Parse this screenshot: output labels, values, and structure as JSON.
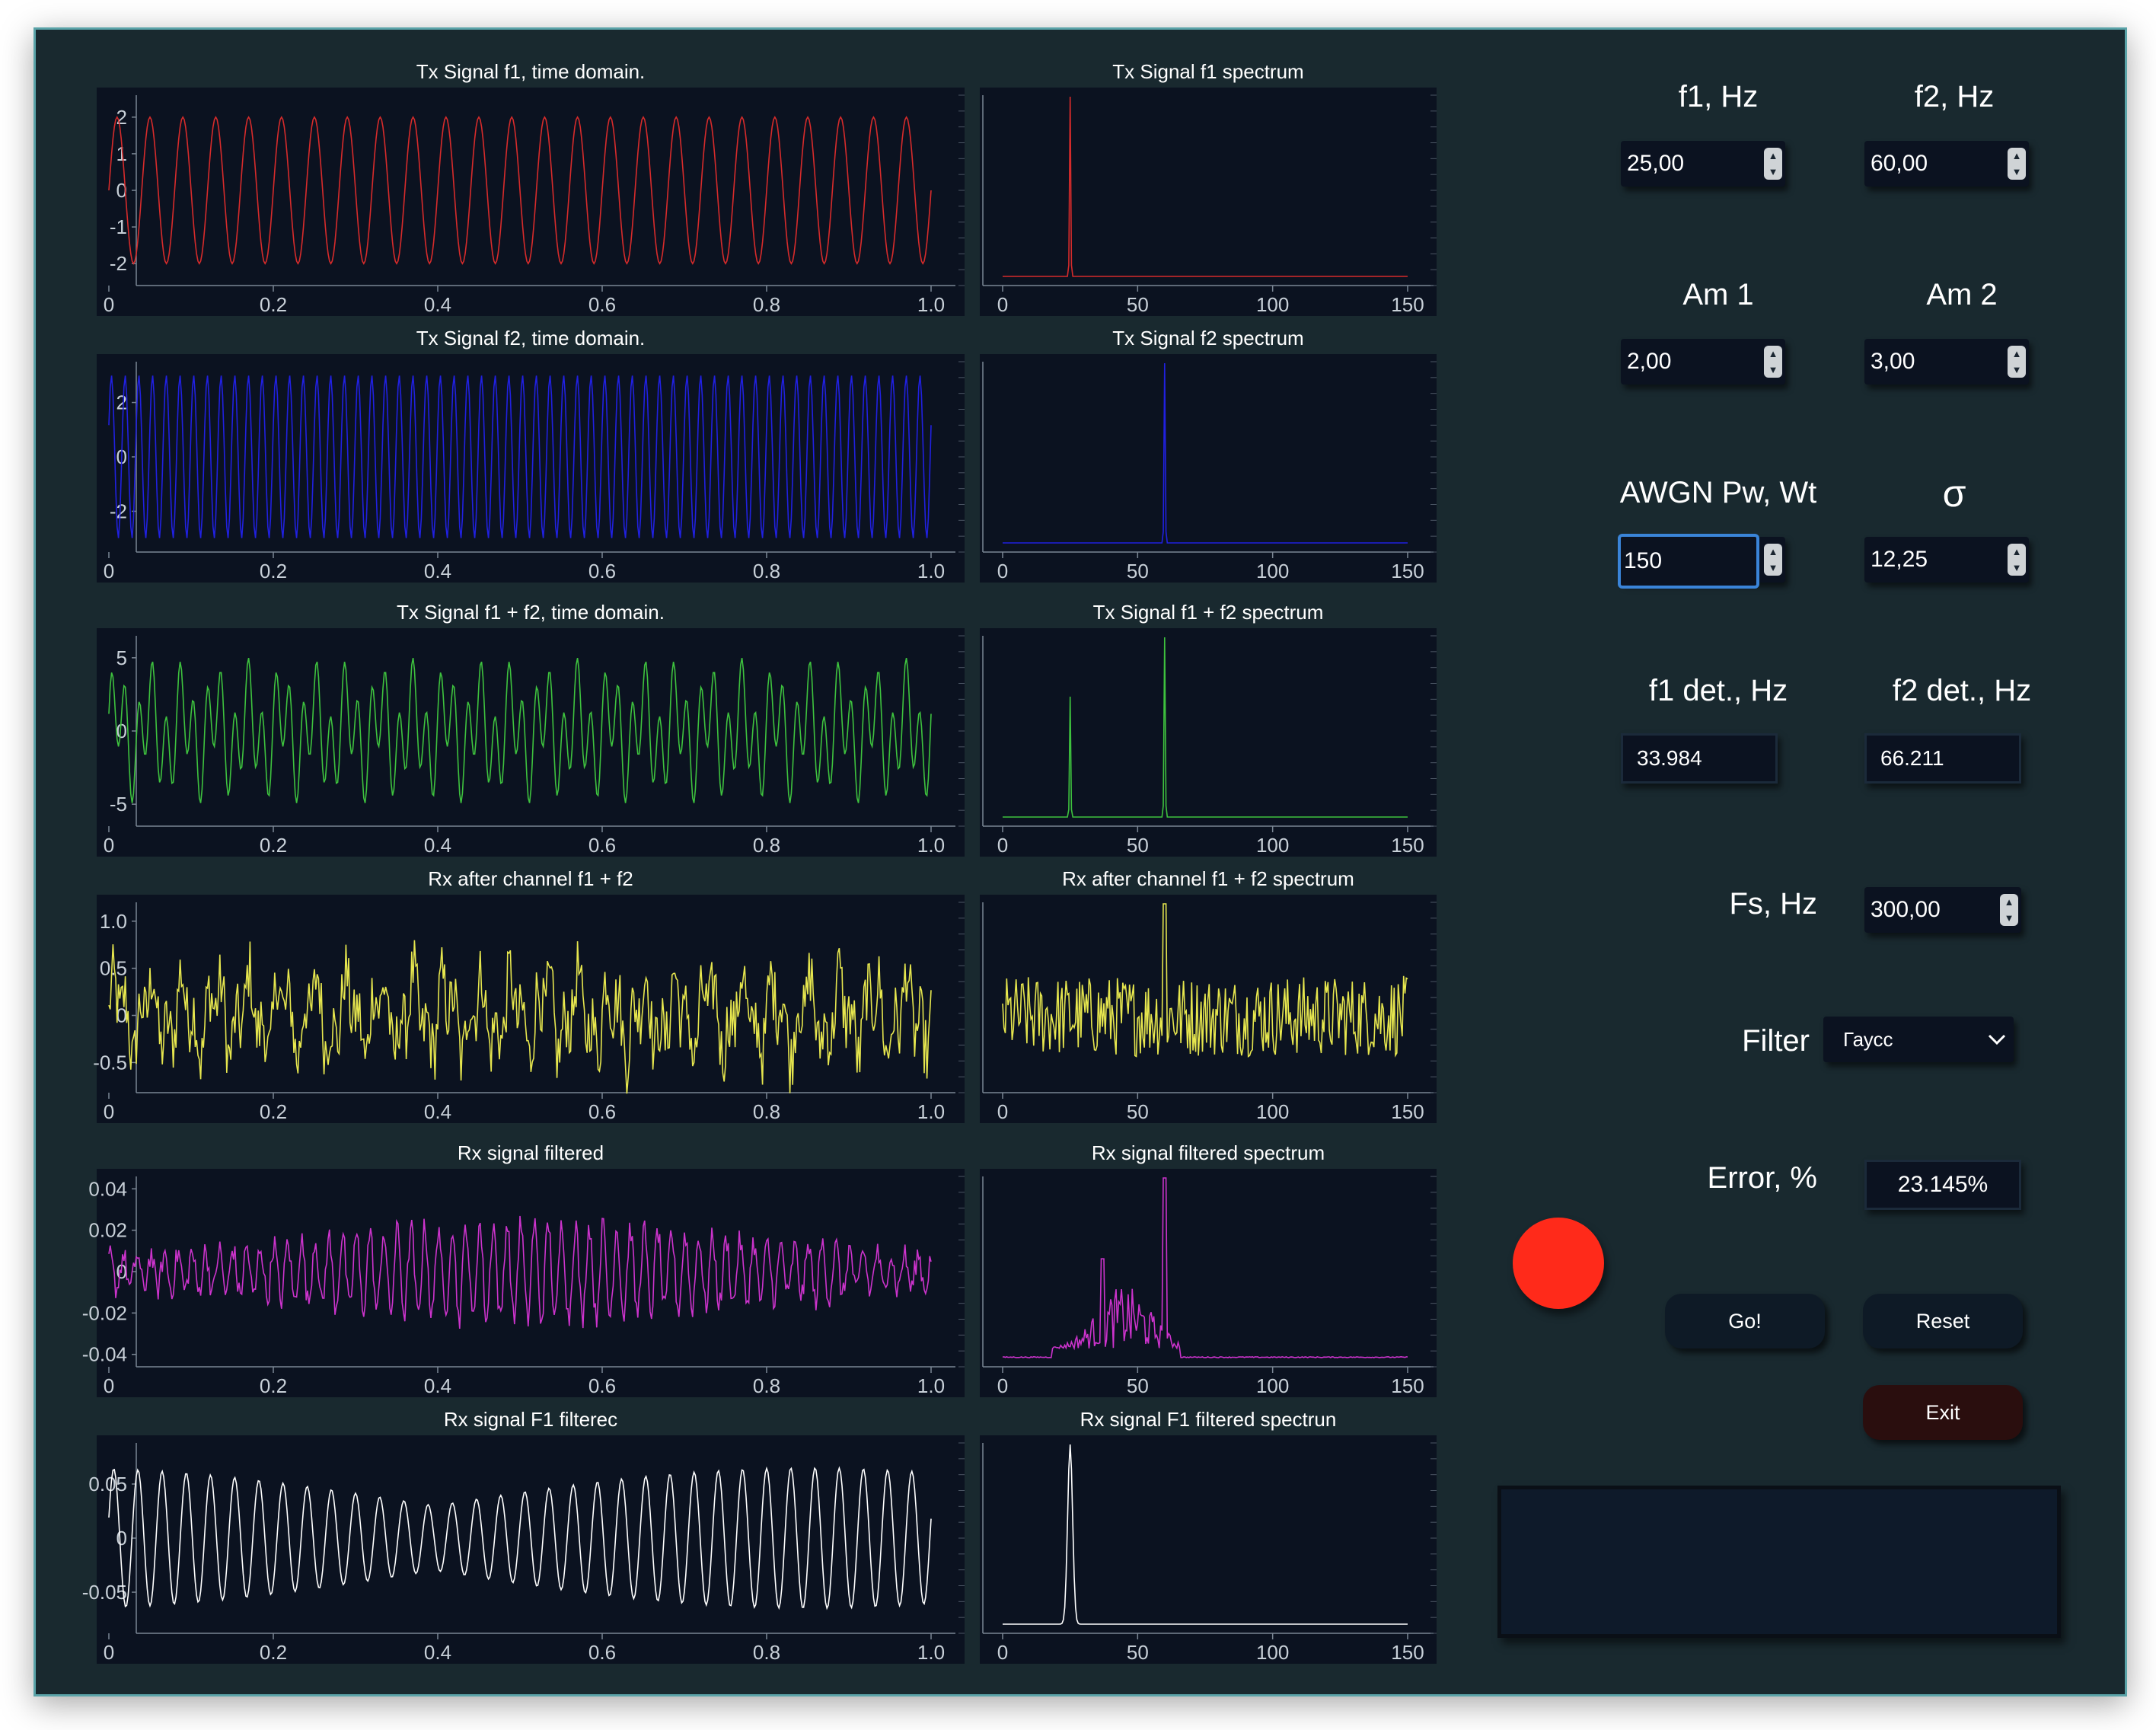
{
  "colors": {
    "window_bg": "#19292f",
    "plot_bg": "#0b1220",
    "f1": "#d62b2b",
    "f2": "#2020e0",
    "sum": "#3ec23e",
    "rx": "#e6e64e",
    "filtered": "#cc33cc",
    "f1_filtered": "#ffffff",
    "indicator": "#ff2a1a",
    "input_focus": "#3a84d8"
  },
  "plots": [
    {
      "title": "Tx Signal f1, time domain.",
      "color_key": "f1"
    },
    {
      "title": "Tx Signal f1 spectrum",
      "color_key": "f1"
    },
    {
      "title": "Tx Signal f2, time domain.",
      "color_key": "f2"
    },
    {
      "title": "Tx Signal f2 spectrum",
      "color_key": "f2"
    },
    {
      "title": "Tx Signal f1 + f2, time domain.",
      "color_key": "sum"
    },
    {
      "title": "Tx Signal f1 + f2 spectrum",
      "color_key": "sum"
    },
    {
      "title": "Rx after channel f1 + f2",
      "color_key": "rx"
    },
    {
      "title": "Rx after channel f1 + f2 spectrum",
      "color_key": "rx"
    },
    {
      "title": "Rx signal filtered",
      "color_key": "filtered"
    },
    {
      "title": "Rx signal filtered spectrum",
      "color_key": "filtered"
    },
    {
      "title": "Rx signal F1 filterec",
      "color_key": "f1_filtered"
    },
    {
      "title": "Rx signal F1 filtered spectrun",
      "color_key": "f1_filtered"
    }
  ],
  "axes": {
    "time_x_ticks": [
      "0",
      "0.2",
      "0.4",
      "0.6",
      "0.8",
      "1.0"
    ],
    "spec_x_ticks": [
      "0",
      "50",
      "100",
      "150"
    ],
    "f1_y_ticks": [
      "2",
      "1",
      "0",
      "-1",
      "-2"
    ],
    "f2_y_ticks": [
      "2",
      "0",
      "-2"
    ],
    "sum_y_ticks": [
      "5",
      "0",
      "-5"
    ],
    "rx_y_ticks": [
      "1.0",
      "0.5",
      "0",
      "-0.5"
    ],
    "filt_y_ticks": [
      "0.04",
      "0.02",
      "0",
      "-0.02",
      "-0.04"
    ],
    "f1f_y_ticks": [
      "0.05",
      "0",
      "-0.05"
    ]
  },
  "chart_data": [
    {
      "type": "line",
      "title": "Tx Signal f1, time domain.",
      "x_range": [
        0,
        1
      ],
      "ylim": [
        -2,
        2
      ],
      "frequency_hz": 25,
      "amplitude": 2
    },
    {
      "type": "line",
      "title": "Tx Signal f1 spectrum",
      "x_range": [
        0,
        150
      ],
      "peaks": [
        {
          "x": 25,
          "y": 1
        }
      ]
    },
    {
      "type": "line",
      "title": "Tx Signal f2, time domain.",
      "x_range": [
        0,
        1
      ],
      "ylim": [
        -3,
        3
      ],
      "frequency_hz": 60,
      "amplitude": 3
    },
    {
      "type": "line",
      "title": "Tx Signal f2 spectrum",
      "x_range": [
        0,
        150
      ],
      "peaks": [
        {
          "x": 60,
          "y": 1
        }
      ]
    },
    {
      "type": "line",
      "title": "Tx Signal f1 + f2, time domain.",
      "x_range": [
        0,
        1
      ],
      "ylim": [
        -5,
        5
      ]
    },
    {
      "type": "line",
      "title": "Tx Signal f1 + f2 spectrum",
      "x_range": [
        0,
        150
      ],
      "peaks": [
        {
          "x": 25,
          "y": 0.67
        },
        {
          "x": 60,
          "y": 1
        }
      ]
    },
    {
      "type": "line",
      "title": "Rx after channel f1 + f2",
      "x_range": [
        0,
        1
      ],
      "ylim": [
        -0.7,
        1.1
      ]
    },
    {
      "type": "line",
      "title": "Rx after channel f1 + f2 spectrum",
      "x_range": [
        0,
        150
      ],
      "peaks": [
        {
          "x": 60,
          "y": 1
        }
      ]
    },
    {
      "type": "line",
      "title": "Rx signal filtered",
      "x_range": [
        0,
        1
      ],
      "ylim": [
        -0.04,
        0.04
      ]
    },
    {
      "type": "line",
      "title": "Rx signal filtered spectrum",
      "x_range": [
        0,
        150
      ],
      "peaks": [
        {
          "x": 60,
          "y": 1
        }
      ]
    },
    {
      "type": "line",
      "title": "Rx signal F1 filterec",
      "x_range": [
        0,
        1
      ],
      "ylim": [
        -0.07,
        0.07
      ]
    },
    {
      "type": "line",
      "title": "Rx signal F1 filtered spectrun",
      "x_range": [
        0,
        150
      ],
      "peaks": [
        {
          "x": 25,
          "y": 1
        }
      ]
    }
  ],
  "controls": {
    "f1_label": "f1, Hz",
    "f1_value": "25,00",
    "f2_label": "f2, Hz",
    "f2_value": "60,00",
    "am1_label": "Am 1",
    "am1_value": "2,00",
    "am2_label": "Am 2",
    "am2_value": "3,00",
    "awgn_label": "AWGN Pw, Wt",
    "awgn_value": "150",
    "sigma_label": "σ",
    "sigma_value": "12,25",
    "f1det_label": "f1 det., Hz",
    "f1det_value": "33.984",
    "f2det_label": "f2 det., Hz",
    "f2det_value": "66.211",
    "fs_label": "Fs, Hz",
    "fs_value": "300,00",
    "filter_label": "Filter",
    "filter_value": "Гаусс",
    "error_label": "Error,  %",
    "error_value": "23.145%",
    "go_label": "Go!",
    "reset_label": "Reset",
    "exit_label": "Exit"
  }
}
